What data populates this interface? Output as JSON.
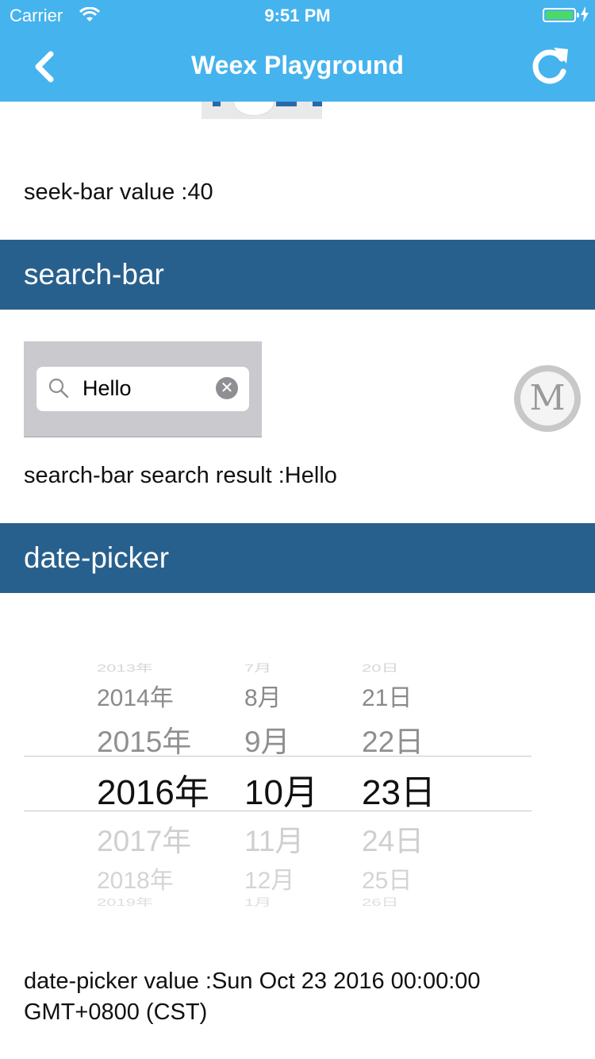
{
  "status_bar": {
    "carrier": "Carrier",
    "time": "9:51 PM"
  },
  "nav": {
    "title": "Weex Playground",
    "back_icon": "chevron-left-icon",
    "refresh_icon": "refresh-icon"
  },
  "seek_bar": {
    "value_text": "seek-bar value :40"
  },
  "search_bar": {
    "header": "search-bar",
    "input_value": "Hello",
    "result_text": "search-bar search result :Hello"
  },
  "floating_badge": {
    "letter": "M"
  },
  "date_picker": {
    "header": "date-picker",
    "years": [
      "2013年",
      "2014年",
      "2015年",
      "2016年",
      "2017年",
      "2018年",
      "2019年"
    ],
    "months": [
      "7月",
      "8月",
      "9月",
      "10月",
      "11月",
      "12月",
      "1月"
    ],
    "days": [
      "20日",
      "21日",
      "22日",
      "23日",
      "24日",
      "25日",
      "26日"
    ],
    "selected_index": 3,
    "value_line1": "date-picker value :Sun Oct 23 2016 00:00:00",
    "value_line2": "GMT+0800 (CST)"
  }
}
